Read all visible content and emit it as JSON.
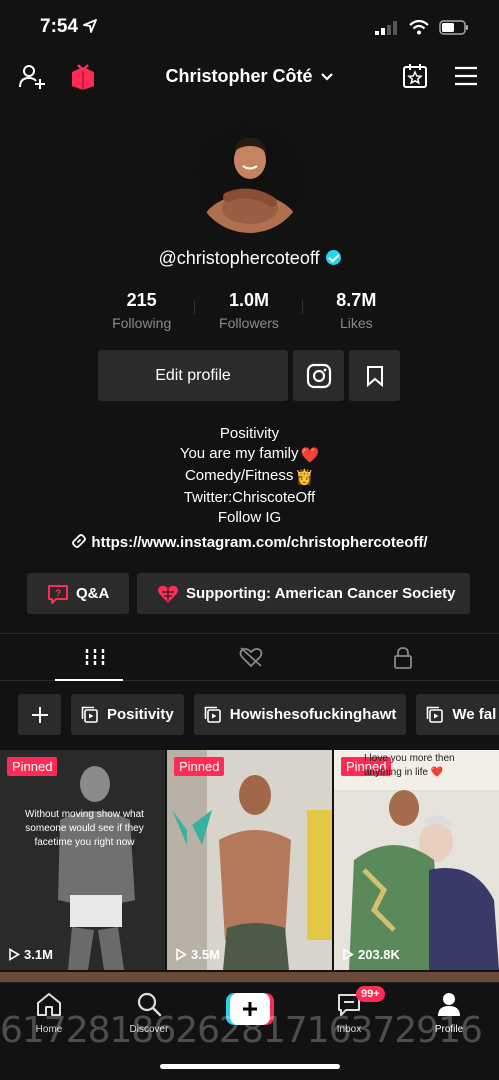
{
  "status": {
    "time": "7:54"
  },
  "header": {
    "title": "Christopher Côté"
  },
  "profile": {
    "username": "@christophercoteoff",
    "stats": [
      {
        "value": "215",
        "label": "Following"
      },
      {
        "value": "1.0M",
        "label": "Followers"
      },
      {
        "value": "8.7M",
        "label": "Likes"
      }
    ],
    "edit_label": "Edit profile",
    "bio": [
      "Positivity",
      "You are my family",
      "Comedy/Fitness",
      "Twitter:ChriscoteOff",
      "Follow IG"
    ],
    "bio_emojis": {
      "heart": "❤️",
      "queen": "👸"
    },
    "link": "https://www.instagram.com/christophercoteoff/",
    "qa_label": "Q&A",
    "supporting_label": "Supporting: American Cancer Society"
  },
  "playlists": [
    "Positivity",
    "Howishesofuckinghawt",
    "We fal"
  ],
  "videos": [
    {
      "pinned": "Pinned",
      "views": "3.1M",
      "overlay": "Without moving show what someone would see if they facetime you right now"
    },
    {
      "pinned": "Pinned",
      "views": "3.5M",
      "overlay": ""
    },
    {
      "pinned": "Pinned",
      "views": "203.8K",
      "overlay": "I love you more then anything in life ❤️"
    }
  ],
  "nav": {
    "home": "Home",
    "discover": "Discover",
    "inbox": "Inbox",
    "inbox_badge": "99+",
    "profile": "Profile"
  },
  "watermark": "6172818626281716372916",
  "colors": {
    "accent": "#fe2c55",
    "verified": "#20d5ec",
    "background": "#121212"
  }
}
